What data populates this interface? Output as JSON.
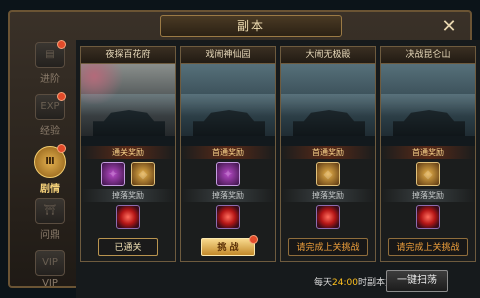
{
  "window": {
    "title": "副本"
  },
  "sidebar": [
    {
      "label": "进阶",
      "icon": "scroll-icon",
      "active": false,
      "badge": true
    },
    {
      "label": "经验",
      "icon": "exp-icon",
      "active": false,
      "badge": true,
      "icon_text": "EXP"
    },
    {
      "label": "剧情",
      "icon": "story-book-icon",
      "active": true,
      "badge": true
    },
    {
      "label": "问鼎",
      "icon": "tower-icon",
      "active": false,
      "badge": false
    },
    {
      "label": "VIP",
      "icon": "vip-icon",
      "active": false,
      "badge": false,
      "icon_text": "VIP"
    }
  ],
  "cards": [
    {
      "title": "夜探百花府",
      "reward_label": "通关奖励",
      "rewards": [
        "purple",
        "gold"
      ],
      "drop_label": "掉落奖励",
      "button": "已通关",
      "button_style": "dark"
    },
    {
      "title": "戏闹神仙园",
      "reward_label": "首通奖励",
      "rewards": [
        "purple"
      ],
      "drop_label": "掉落奖励",
      "button": "挑 战",
      "button_style": "gold",
      "button_badge": true
    },
    {
      "title": "大闹无极殿",
      "reward_label": "首通奖励",
      "rewards": [
        "gold"
      ],
      "drop_label": "掉落奖励",
      "button": "请完成上关挑战",
      "button_style": "redtxt"
    },
    {
      "title": "决战昆仑山",
      "reward_label": "首通奖励",
      "rewards": [
        "gold"
      ],
      "drop_label": "掉落奖励",
      "button": "请完成上关挑战",
      "button_style": "redtxt"
    }
  ],
  "footer": {
    "reset_prefix": "每天",
    "reset_time": "24:00",
    "reset_suffix": "时副本重置",
    "sweep_button": "一键扫荡"
  },
  "colors": {
    "accent_gold": "#f6d27a",
    "warning_orange": "#f2a23c",
    "highlight_yellow": "#ffc11e"
  }
}
